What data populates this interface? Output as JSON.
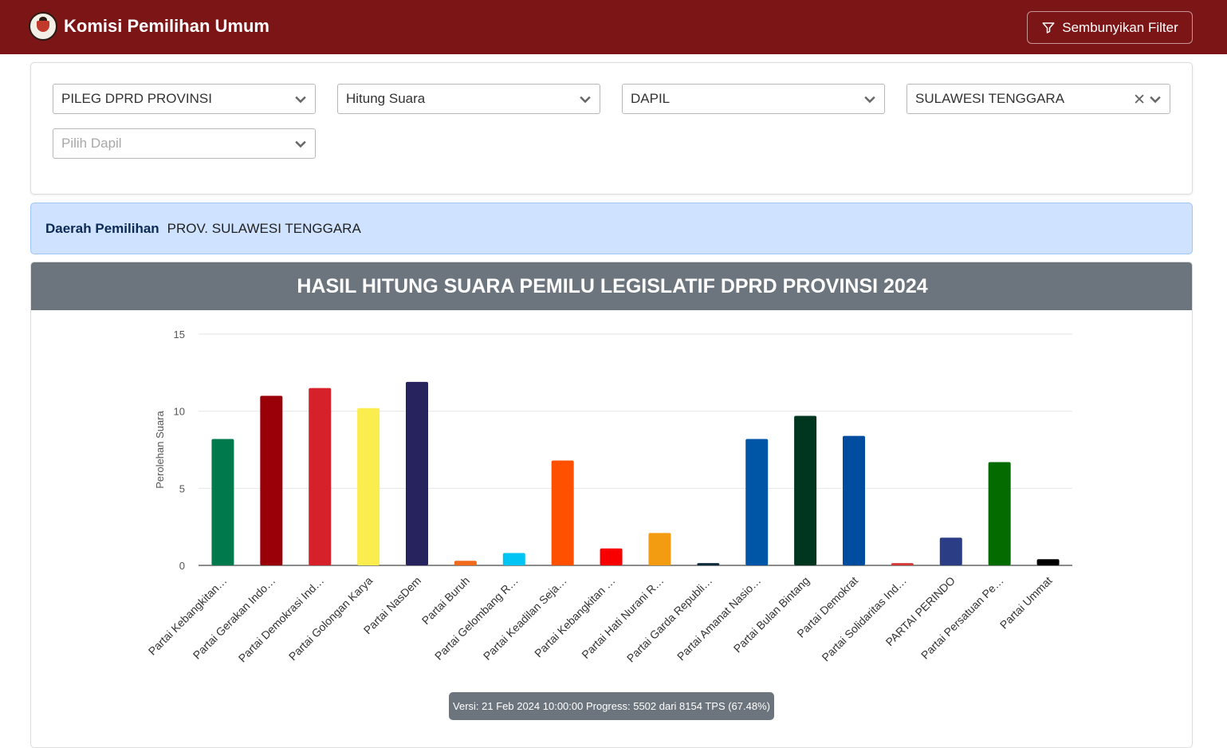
{
  "header": {
    "app_title": "Komisi Pemilihan Umum",
    "filter_button_label": "Sembunyikan Filter",
    "filter_icon": "funnel-icon",
    "logo_icon": "kpu-logo-icon"
  },
  "filters": {
    "election_type": "PILEG DPRD PROVINSI",
    "count_type": "Hitung Suara",
    "region_level": "DAPIL",
    "province": "SULAWESI TENGGARA",
    "dapil_placeholder": "Pilih Dapil"
  },
  "info": {
    "label": "Daerah Pemilihan",
    "value": "PROV. SULAWESI TENGGARA"
  },
  "chart_card": {
    "title": "HASIL HITUNG SUARA PEMILU LEGISLATIF DPRD PROVINSI 2024",
    "version_text": "Versi: 21 Feb 2024 10:00:00 Progress: 5502 dari 8154 TPS (67.48%)"
  },
  "colors": {
    "topbar": "#7b1516",
    "header_gray": "#6c757d",
    "info_bg": "#cfe2ff"
  },
  "chart_data": {
    "type": "bar",
    "ylabel": "Perolehan Suara",
    "xlabel": "",
    "ylim": [
      0,
      15
    ],
    "yticks": [
      0,
      5,
      10,
      15
    ],
    "grid": true,
    "categories": [
      "Partai Kebangkitan…",
      "Partai Gerakan Indo…",
      "Partai Demokrasi Ind…",
      "Partai Golongan Karya",
      "Partai NasDem",
      "Partai Buruh",
      "Partai Gelombang R…",
      "Partai Keadilan Seja…",
      "Partai Kebangkitan …",
      "Partai Hati Nurani R…",
      "Partai Garda Republi…",
      "Partai Amanat Nasio…",
      "Partai Bulan Bintang",
      "Partai Demokrat",
      "Partai Solidaritas Ind…",
      "PARTAI PERINDO",
      "Partai Persatuan Pe…",
      "Partai Ummat"
    ],
    "values": [
      8.2,
      11.0,
      11.5,
      10.2,
      11.9,
      0.3,
      0.8,
      6.8,
      1.1,
      2.1,
      0.15,
      8.2,
      9.7,
      8.4,
      0.15,
      1.8,
      6.7,
      0.4
    ],
    "colors": [
      "#007a4d",
      "#9a0008",
      "#d6202a",
      "#fbed4d",
      "#27235f",
      "#f26a1b",
      "#00c4f3",
      "#ff5000",
      "#f80000",
      "#f39c12",
      "#0b2a3c",
      "#0056a6",
      "#00351f",
      "#004c9e",
      "#d43a3a",
      "#2a3d85",
      "#036b00",
      "#000000"
    ]
  }
}
